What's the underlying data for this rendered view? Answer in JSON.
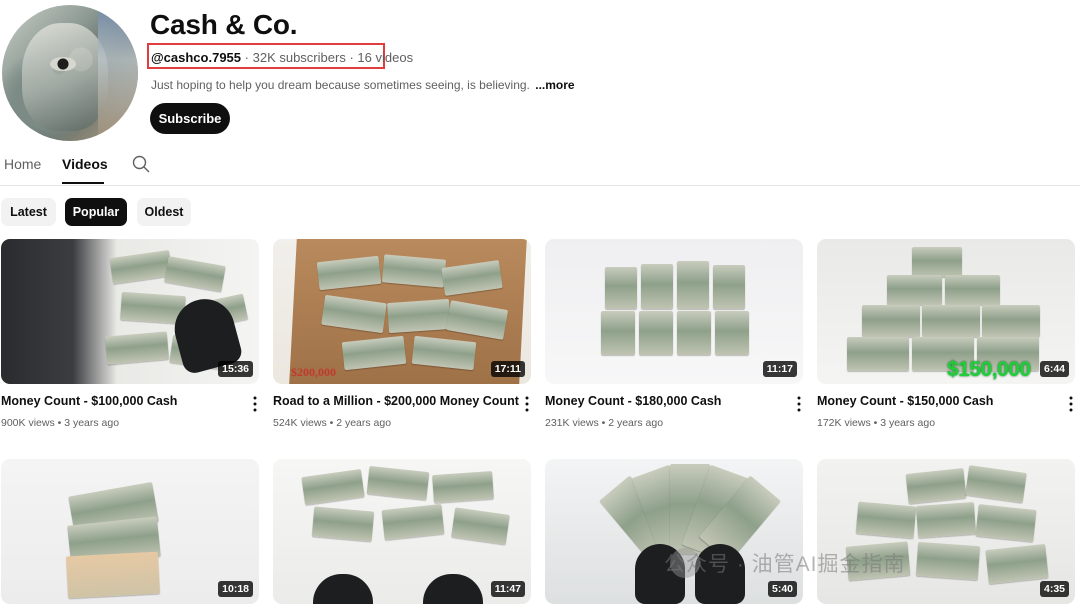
{
  "channel": {
    "title": "Cash & Co.",
    "handle": "@cashco.7955",
    "subscribers": "32K subscribers",
    "videos_count": "16 videos",
    "separator": "·",
    "description": "Just hoping to help you dream because sometimes seeing, is believing.",
    "more_label": "...more",
    "subscribe_label": "Subscribe"
  },
  "tabs": [
    {
      "label": "Home"
    },
    {
      "label": "Videos"
    }
  ],
  "icons": {
    "search": "search-icon",
    "menu": "more-vert-icon"
  },
  "chips": [
    {
      "label": "Latest"
    },
    {
      "label": "Popular"
    },
    {
      "label": "Oldest"
    }
  ],
  "videos": [
    {
      "title": "Money Count - $100,000 Cash",
      "stats": "900K views • 3 years ago",
      "duration": "15:36"
    },
    {
      "title": "Road to a Million - $200,000 Money Count",
      "stats": "524K views • 2 years ago",
      "duration": "17:11",
      "overlay": "$200,000"
    },
    {
      "title": "Money Count - $180,000 Cash",
      "stats": "231K views • 2 years ago",
      "duration": "11:17"
    },
    {
      "title": "Money Count - $150,000 Cash",
      "stats": "172K views • 3 years ago",
      "duration": "6:44",
      "overlay": "$150,000"
    },
    {
      "duration": "10:18"
    },
    {
      "duration": "11:47"
    },
    {
      "duration": "5:40"
    },
    {
      "duration": "4:35"
    }
  ],
  "watermark": "公众号 · 油管AI掘金指南",
  "colors": {
    "highlight_box": "#e23d3d",
    "overlay_red": "#c0392b",
    "overlay_green": "#1fcf3a"
  }
}
